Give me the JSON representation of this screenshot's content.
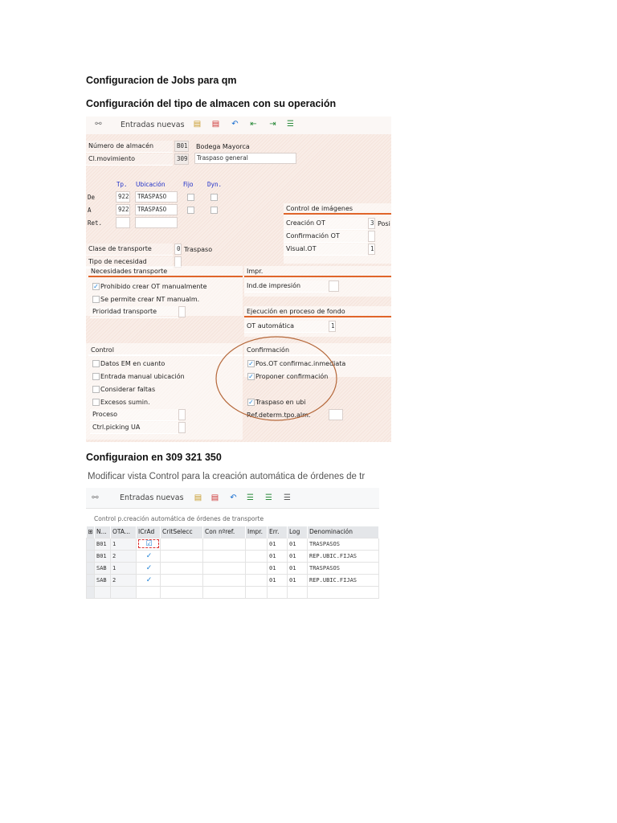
{
  "doc": {
    "heading1": "Configuracion de Jobs para qm",
    "heading2": "Configuración del tipo de almacen con su operación",
    "heading3": "Configuraion en  309 321 350"
  },
  "screen1": {
    "toolbar": {
      "entradas": "Entradas nuevas"
    },
    "almacen": {
      "label": "Número de almacén",
      "value": "B01",
      "desc": "Bodega Mayorca"
    },
    "movimiento": {
      "label": "Cl.movimiento",
      "value": "309",
      "desc": "Traspaso general"
    },
    "cols": {
      "tp": "Tp.",
      "ubic": "Ubicación",
      "fijo": "Fijo",
      "dyn": "Dyn."
    },
    "rows": [
      {
        "label": "De",
        "tp": "922",
        "ubic": "TRASPASO"
      },
      {
        "label": "A",
        "tp": "922",
        "ubic": "TRASPASO"
      },
      {
        "label": "Ret.",
        "tp": "",
        "ubic": ""
      }
    ],
    "clase": {
      "label": "Clase de transporte",
      "value": "0",
      "desc": "Traspaso"
    },
    "tipo_necesidad": "Tipo de necesidad",
    "imagenes": {
      "title": "Control de imágenes",
      "creacion": "Creación OT",
      "creacion_val": "3",
      "creacion_desc": "Posi",
      "confirmacion": "Confirmación OT",
      "visual": "Visual.OT",
      "visual_val": "1"
    },
    "necesidades": {
      "title": "Necesidades transporte",
      "prohibido": "Prohibido crear OT manualmente",
      "permite": "Se permite crear NT manualm.",
      "prioridad": "Prioridad transporte"
    },
    "impr": {
      "title": "Impr.",
      "ind": "Ind.de impresión"
    },
    "ejecucion": {
      "title": "Ejecución en proceso de fondo",
      "ot": "OT automática",
      "ot_val": "1"
    },
    "control": {
      "title": "Control",
      "datos": "Datos EM en cuanto",
      "entrada": "Entrada manual ubicación",
      "considerar": "Considerar faltas",
      "excesos": "Excesos sumin.",
      "proceso": "Proceso",
      "ctrl": "Ctrl.picking UA"
    },
    "confirmacion": {
      "title": "Confirmación",
      "pos": "Pos.OT confirmac.inmediata",
      "proponer": "Proponer confirmación",
      "traspaso": "Traspaso en ubi",
      "ref": "Ref.determ.tpo.alm."
    }
  },
  "screen2": {
    "title": "Modificar vista Control para la creación automática de órdenes de tr",
    "toolbar": {
      "entradas": "Entradas nuevas"
    },
    "section": "Control p.creación automática de órdenes de transporte",
    "headers": [
      "N...",
      "OTA...",
      "ICrAd",
      "CritSelecc",
      "Con nºref.",
      "Impr.",
      "Err.",
      "Log",
      "Denominación"
    ],
    "rows": [
      {
        "n": "B01",
        "ota": "1",
        "err": "01",
        "log": "01",
        "den": "TRASPASOS"
      },
      {
        "n": "B01",
        "ota": "2",
        "err": "01",
        "log": "01",
        "den": "REP.UBIC.FIJAS"
      },
      {
        "n": "SAB",
        "ota": "1",
        "err": "01",
        "log": "01",
        "den": "TRASPASOS"
      },
      {
        "n": "SAB",
        "ota": "2",
        "err": "01",
        "log": "01",
        "den": "REP.UBIC.FIJAS"
      }
    ]
  },
  "colors": {
    "accent": "#e0652a",
    "check": "#1a7fd6",
    "annotation": "#b5683a"
  }
}
